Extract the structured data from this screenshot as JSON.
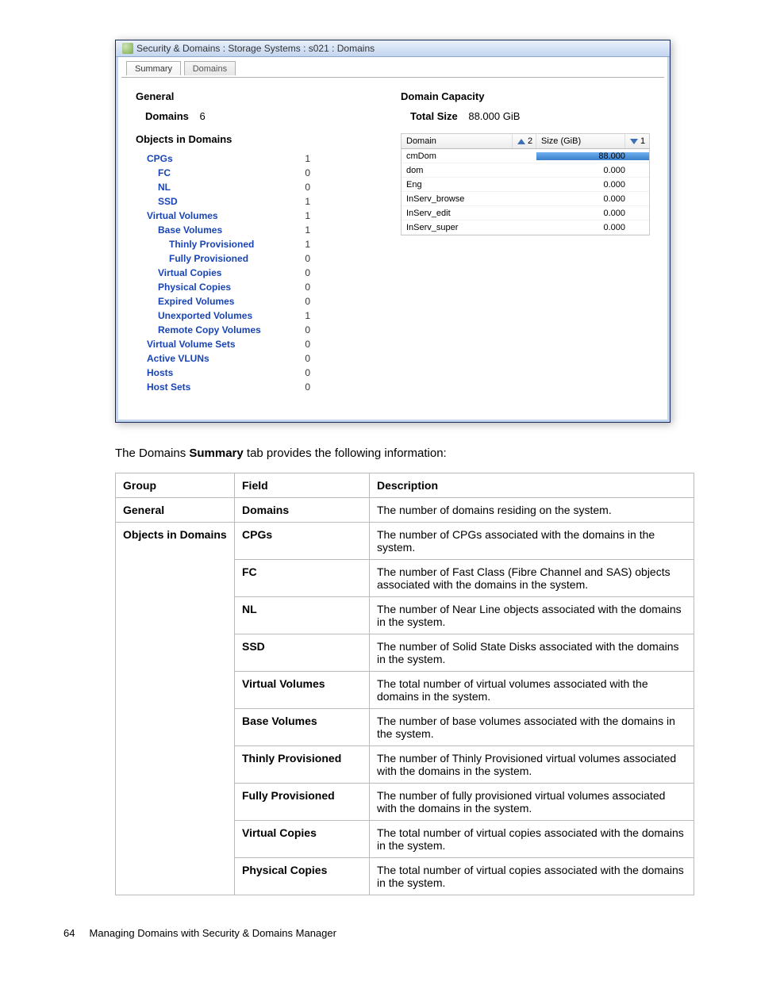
{
  "window": {
    "title": "Security & Domains : Storage Systems : s021 : Domains",
    "tabs": [
      {
        "label": "Summary",
        "active": true
      },
      {
        "label": "Domains",
        "active": false
      }
    ],
    "general": {
      "heading": "General",
      "domains_label": "Domains",
      "domains_value": "6"
    },
    "objects_heading": "Objects in Domains",
    "objects": [
      {
        "label": "CPGs",
        "value": "1",
        "link": true,
        "indent": 1
      },
      {
        "label": "FC",
        "value": "0",
        "link": true,
        "indent": 2
      },
      {
        "label": "NL",
        "value": "0",
        "link": true,
        "indent": 2
      },
      {
        "label": "SSD",
        "value": "1",
        "link": true,
        "indent": 2
      },
      {
        "label": "Virtual Volumes",
        "value": "1",
        "link": true,
        "indent": 1
      },
      {
        "label": "Base Volumes",
        "value": "1",
        "link": true,
        "indent": 2
      },
      {
        "label": "Thinly Provisioned",
        "value": "1",
        "link": true,
        "indent": 3
      },
      {
        "label": "Fully Provisioned",
        "value": "0",
        "link": true,
        "indent": 3
      },
      {
        "label": "Virtual Copies",
        "value": "0",
        "link": true,
        "indent": 2
      },
      {
        "label": "Physical Copies",
        "value": "0",
        "link": true,
        "indent": 2
      },
      {
        "label": "Expired Volumes",
        "value": "0",
        "link": true,
        "indent": 2
      },
      {
        "label": "Unexported Volumes",
        "value": "1",
        "link": true,
        "indent": 2
      },
      {
        "label": "Remote Copy Volumes",
        "value": "0",
        "link": true,
        "indent": 2
      },
      {
        "label": "Virtual Volume Sets",
        "value": "0",
        "link": true,
        "indent": 1
      },
      {
        "label": "Active VLUNs",
        "value": "0",
        "link": true,
        "indent": 1
      },
      {
        "label": "Hosts",
        "value": "0",
        "link": true,
        "indent": 1
      },
      {
        "label": "Host Sets",
        "value": "0",
        "link": true,
        "indent": 1
      }
    ],
    "capacity": {
      "heading": "Domain Capacity",
      "total_label": "Total Size",
      "total_value": "88.000 GiB",
      "columns": {
        "domain": "Domain",
        "domain_sort_num": "2",
        "size": "Size (GiB)",
        "size_sort_num": "1"
      },
      "rows": [
        {
          "domain": "cmDom",
          "size": "88.000",
          "bar_pct": 100
        },
        {
          "domain": "dom",
          "size": "0.000",
          "bar_pct": 0
        },
        {
          "domain": "Eng",
          "size": "0.000",
          "bar_pct": 0
        },
        {
          "domain": "InServ_browse",
          "size": "0.000",
          "bar_pct": 0
        },
        {
          "domain": "InServ_edit",
          "size": "0.000",
          "bar_pct": 0
        },
        {
          "domain": "InServ_super",
          "size": "0.000",
          "bar_pct": 0
        }
      ]
    }
  },
  "caption": {
    "pre": "The Domains ",
    "bold": "Summary",
    "post": " tab provides the following information:"
  },
  "desc_table": {
    "headers": {
      "group": "Group",
      "field": "Field",
      "description": "Description"
    },
    "rows": [
      {
        "group": "General",
        "field": "Domains",
        "desc": "The number of domains residing on the system."
      },
      {
        "group": "Objects in Domains",
        "field": "CPGs",
        "desc": "The number of CPGs associated with the domains in the system."
      },
      {
        "group": "",
        "field": "FC",
        "desc": "The number of Fast Class (Fibre Channel and SAS) objects associated with the domains in the system."
      },
      {
        "group": "",
        "field": "NL",
        "desc": "The number of Near Line objects associated with the domains in the system."
      },
      {
        "group": "",
        "field": "SSD",
        "desc": "The number of Solid State Disks associated with the domains in the system."
      },
      {
        "group": "",
        "field": "Virtual Volumes",
        "desc": "The total number of virtual volumes associated with the domains in the system."
      },
      {
        "group": "",
        "field": "Base Volumes",
        "desc": "The number of base volumes associated with the domains in the system."
      },
      {
        "group": "",
        "field": "Thinly Provisioned",
        "desc": "The number of Thinly Provisioned virtual volumes associated with the domains in the system."
      },
      {
        "group": "",
        "field": "Fully Provisioned",
        "desc": "The number of fully provisioned virtual volumes associated with the domains in the system."
      },
      {
        "group": "",
        "field": "Virtual Copies",
        "desc": "The total number of virtual copies associated with the domains in the system."
      },
      {
        "group": "",
        "field": "Physical Copies",
        "desc": "The total number of virtual copies associated with the domains in the system."
      }
    ]
  },
  "footer": {
    "page_num": "64",
    "title": "Managing Domains with Security & Domains Manager"
  }
}
